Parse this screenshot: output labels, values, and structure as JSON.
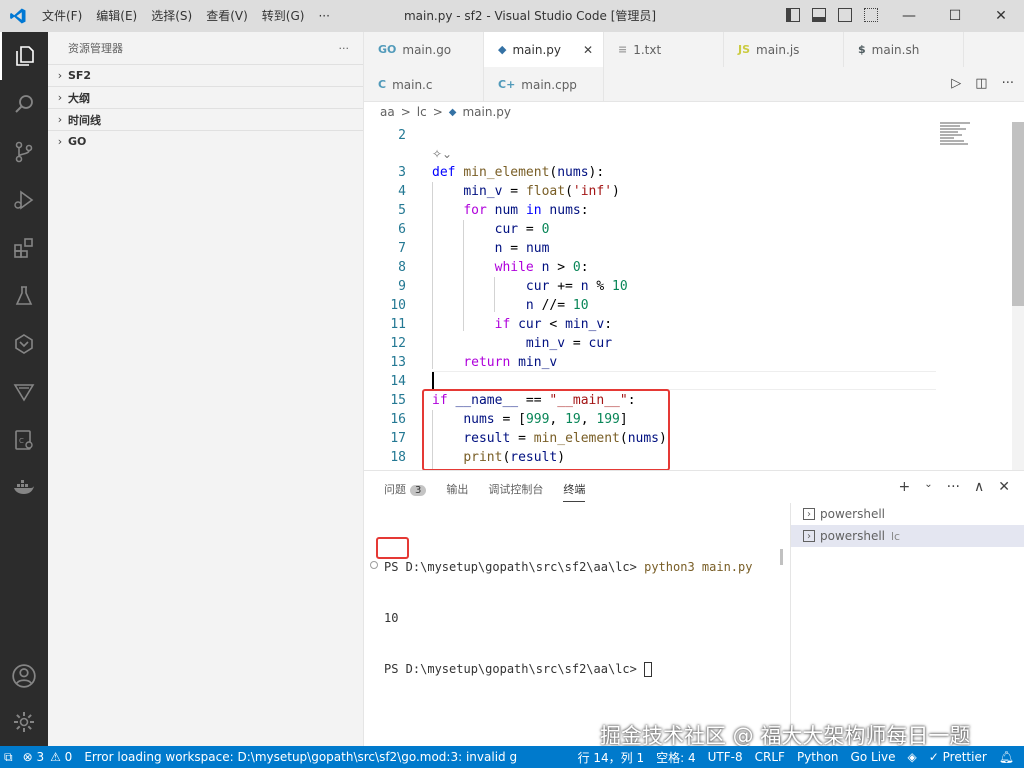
{
  "titlebar": {
    "menu": [
      "文件(F)",
      "编辑(E)",
      "选择(S)",
      "查看(V)",
      "转到(G)",
      "···"
    ],
    "title": "main.py - sf2 - Visual Studio Code [管理员]",
    "win": [
      "—",
      "☐",
      "✕"
    ]
  },
  "sidebar": {
    "header": "资源管理器",
    "more": "···",
    "sections": [
      "SF2",
      "大纲",
      "时间线",
      "GO"
    ]
  },
  "tabs_row1": [
    {
      "icon": "GO",
      "label": "main.go",
      "color": "#519aba"
    },
    {
      "icon": "◆",
      "label": "main.py",
      "color": "#3572a5"
    },
    {
      "icon": "≡",
      "label": "1.txt",
      "color": "#9e9e9e"
    },
    {
      "icon": "JS",
      "label": "main.js",
      "color": "#cbcb41"
    },
    {
      "icon": "$",
      "label": "main.sh",
      "color": "#4d5a5e"
    }
  ],
  "tabs_row2": [
    {
      "icon": "C",
      "label": "main.c",
      "color": "#519aba"
    },
    {
      "icon": "C+",
      "label": "main.cpp",
      "color": "#519aba"
    }
  ],
  "breadcrumb": [
    "aa",
    ">",
    "lc",
    ">",
    "main.py"
  ],
  "code_lines": [
    {
      "n": "2",
      "html": ""
    },
    {
      "n": "3",
      "html": "<span class=\"kw\">def</span> <span class=\"fn\">min_element</span>(<span class=\"var\">nums</span>):"
    },
    {
      "n": "4",
      "html": "    <span class=\"var\">min_v</span> = <span class=\"fn\">float</span>(<span class=\"str\">'inf'</span>)"
    },
    {
      "n": "5",
      "html": "    <span class=\"ctl\">for</span> <span class=\"var\">num</span> <span class=\"kw\">in</span> <span class=\"var\">nums</span>:"
    },
    {
      "n": "6",
      "html": "        <span class=\"var\">cur</span> = <span class=\"num\">0</span>"
    },
    {
      "n": "7",
      "html": "        <span class=\"var\">n</span> = <span class=\"var\">num</span>"
    },
    {
      "n": "8",
      "html": "        <span class=\"ctl\">while</span> <span class=\"var\">n</span> > <span class=\"num\">0</span>:"
    },
    {
      "n": "9",
      "html": "            <span class=\"var\">cur</span> += <span class=\"var\">n</span> % <span class=\"num\">10</span>"
    },
    {
      "n": "10",
      "html": "            <span class=\"var\">n</span> //= <span class=\"num\">10</span>"
    },
    {
      "n": "11",
      "html": "        <span class=\"ctl\">if</span> <span class=\"var\">cur</span> < <span class=\"var\">min_v</span>:"
    },
    {
      "n": "12",
      "html": "            <span class=\"var\">min_v</span> = <span class=\"var\">cur</span>"
    },
    {
      "n": "13",
      "html": "    <span class=\"ctl\">return</span> <span class=\"var\">min_v</span>"
    },
    {
      "n": "14",
      "html": ""
    },
    {
      "n": "15",
      "html": "<span class=\"ctl\">if</span> <span class=\"var\">__name__</span> == <span class=\"str\">\"__main__\"</span>:"
    },
    {
      "n": "16",
      "html": "    <span class=\"var\">nums</span> = [<span class=\"num\">999</span>, <span class=\"num\">19</span>, <span class=\"num\">199</span>]"
    },
    {
      "n": "17",
      "html": "    <span class=\"var\">result</span> = <span class=\"fn\">min_element</span>(<span class=\"var\">nums</span>)"
    },
    {
      "n": "18",
      "html": "    <span class=\"fn\">print</span>(<span class=\"var\">result</span>)"
    }
  ],
  "panel": {
    "tabs": [
      "问题",
      "输出",
      "调试控制台",
      "终端"
    ],
    "problems_count": "3",
    "actions": [
      "+",
      "⌄",
      "···",
      "∧",
      "✕"
    ],
    "terminal_lines": [
      {
        "prompt": "PS D:\\mysetup\\gopath\\src\\sf2\\aa\\lc> ",
        "cmd": "python3 main.py"
      },
      {
        "prompt": "10",
        "cmd": ""
      },
      {
        "prompt": "PS D:\\mysetup\\gopath\\src\\sf2\\aa\\lc> ",
        "cmd": ""
      }
    ],
    "terminal_list": [
      {
        "label": "powershell",
        "suffix": ""
      },
      {
        "label": "powershell",
        "suffix": "lc"
      }
    ]
  },
  "watermark": "掘金技术社区 @ 福大大架构师每日一题",
  "statusbar": {
    "errors": "⊗ 3",
    "warnings": "⚠ 0",
    "message": "Error loading workspace: D:\\mysetup\\gopath\\src\\sf2\\go.mod:3: invalid g",
    "position": "行 14，列 1",
    "spaces": "空格: 4",
    "encoding": "UTF-8",
    "eol": "CRLF",
    "language": "Python",
    "golive": "Go Live",
    "prettier": "✓ Prettier"
  },
  "colors": {
    "accent": "#007acc",
    "highlight_box": "#e53935",
    "activity_bg": "#2c2c2c"
  }
}
